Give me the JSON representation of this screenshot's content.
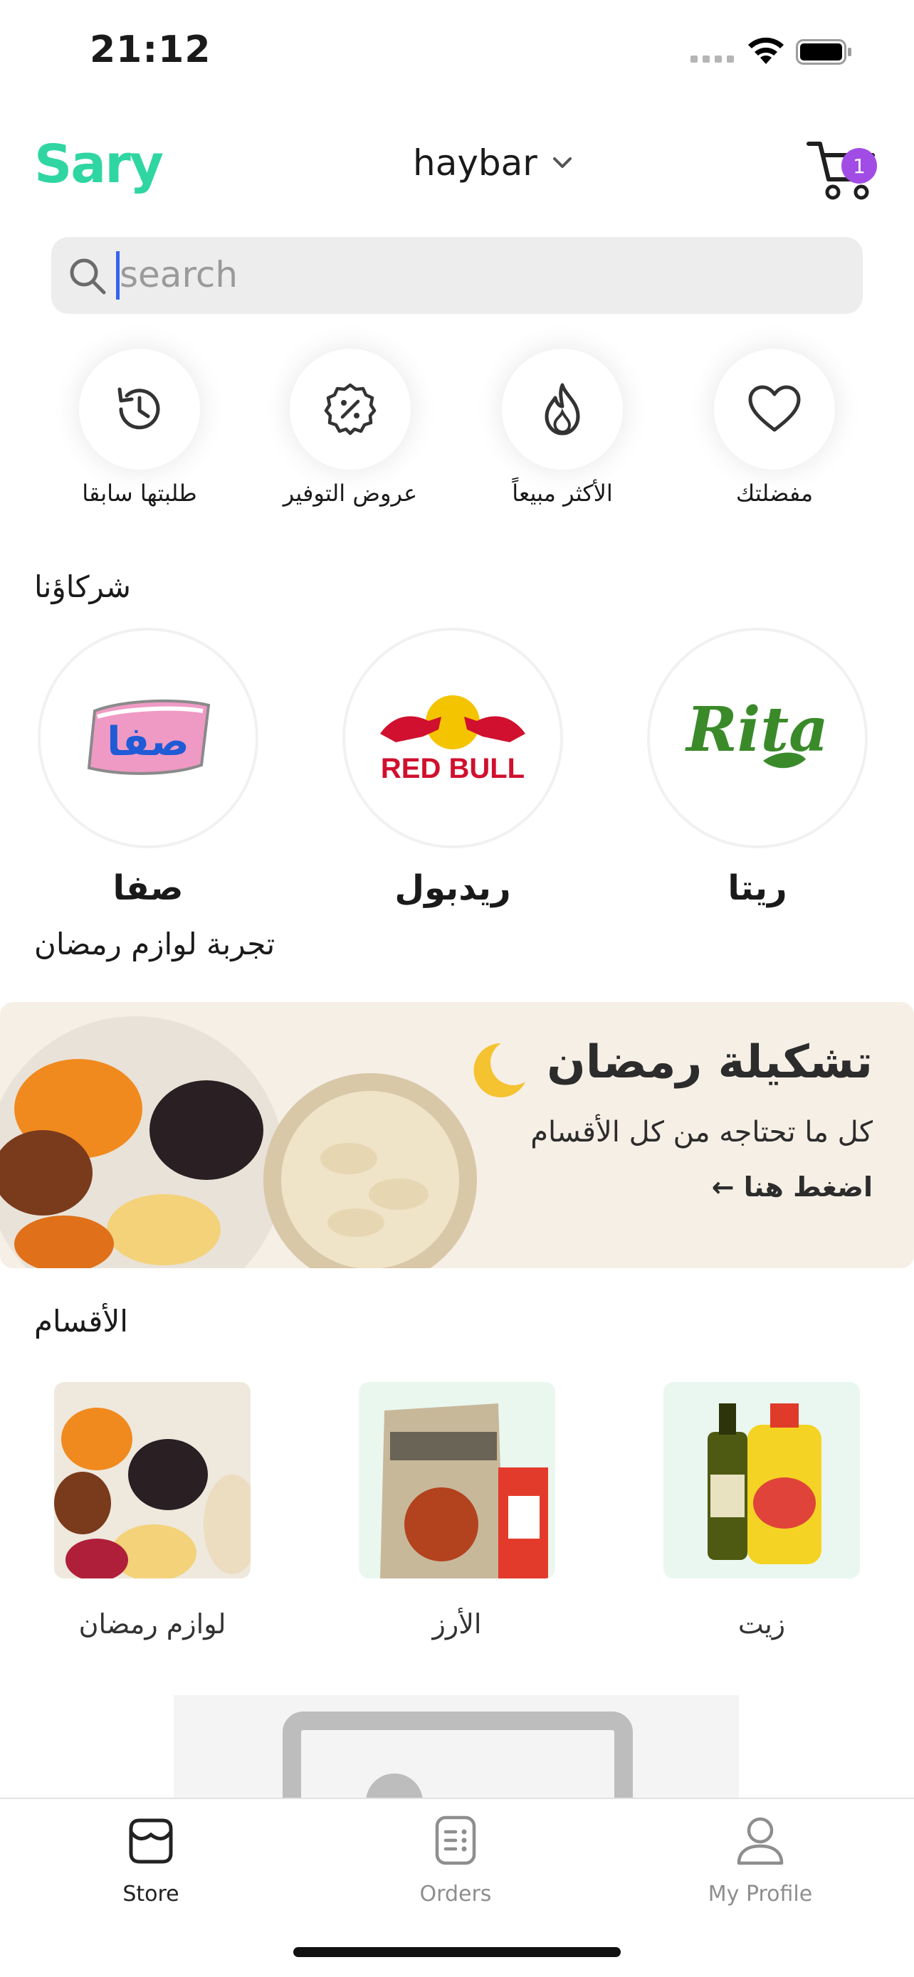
{
  "status_bar": {
    "time": "21:12"
  },
  "header": {
    "logo": "Sary",
    "store_name": "haybar",
    "cart_count": "1"
  },
  "search": {
    "placeholder": "search"
  },
  "quick_actions": [
    {
      "label": "مفضلتك",
      "icon": "heart-icon"
    },
    {
      "label": "الأكثر مبيعاً",
      "icon": "fire-icon"
    },
    {
      "label": "عروض التوفير",
      "icon": "discount-badge-icon"
    },
    {
      "label": "طلبتها سابقا",
      "icon": "history-icon"
    }
  ],
  "partners": {
    "title": "شركاؤنا",
    "items": [
      {
        "name": "ريتا",
        "logo_text": "Rita"
      },
      {
        "name": "ريدبول",
        "logo_text": "RED BULL"
      },
      {
        "name": "صفا",
        "logo_text": "صفا"
      }
    ]
  },
  "promo": {
    "section_title": "تجربة لوازم رمضان",
    "title": "تشكيلة رمضان",
    "subtitle": "كل ما تحتاجه من كل الأقسام",
    "cta": "اضغط هنا"
  },
  "categories": {
    "title": "الأقسام",
    "items": [
      {
        "label": "زيت"
      },
      {
        "label": "الأرز"
      },
      {
        "label": "لوازم رمضان"
      }
    ]
  },
  "tabbar": {
    "items": [
      {
        "label": "Store",
        "active": true
      },
      {
        "label": "Orders",
        "active": false
      },
      {
        "label": "My Profile",
        "active": false
      }
    ]
  },
  "colors": {
    "brand": "#2fd6a1",
    "badge": "#a24ce6",
    "caret": "#3464f0"
  }
}
